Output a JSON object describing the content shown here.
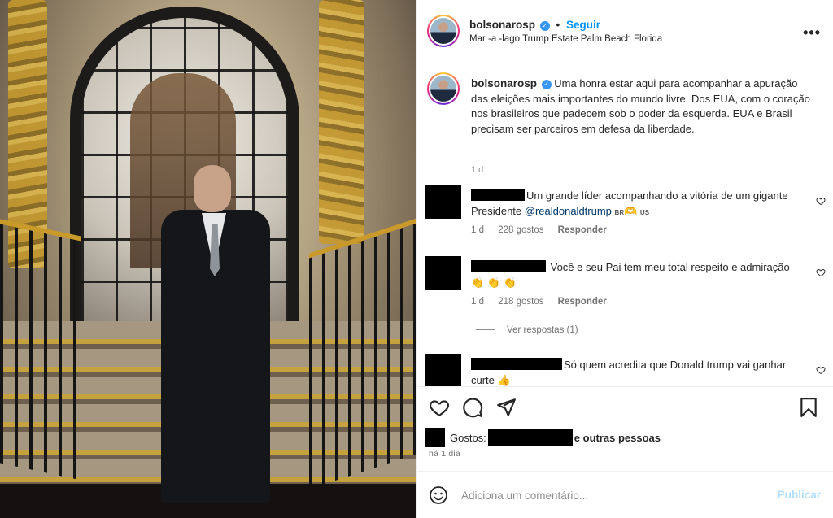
{
  "post": {
    "username": "bolsonarosp",
    "follow_label": "Seguir",
    "location": "Mar -a -lago Trump Estate Palm Beach Florida",
    "more_icon": "more-options-icon",
    "caption_username": "bolsonarosp",
    "caption_text": "Uma honra estar aqui para acompanhar a apuração das eleições mais importantes do mundo livre. Dos EUA, com o coração nos brasileiros que padecem sob o poder da esquerda. EUA e Brasil precisam ser parceiros em defesa da liberdade.",
    "caption_time": "1 d"
  },
  "comments": [
    {
      "text_before": "Um grande líder acompanhando a vitória de um gigante Presidente ",
      "mention": "@realdonaldtrump",
      "flag_br": "BR",
      "emoji": "🫶",
      "flag_us": "US",
      "time": "1 d",
      "likes": "228 gostos",
      "reply_label": "Responder"
    },
    {
      "text": "Você e seu Pai tem meu total respeito e admiração",
      "emoji": "👏 👏 👏",
      "time": "1 d",
      "likes": "218 gostos",
      "reply_label": "Responder",
      "view_replies": "Ver respostas (1)"
    },
    {
      "text": "Só quem acredita que Donald trump vai ganhar curte",
      "emoji": "👍"
    }
  ],
  "actions": {
    "like_icon": "heart-icon",
    "comment_icon": "comment-icon",
    "share_icon": "share-icon",
    "save_icon": "bookmark-icon"
  },
  "likes": {
    "prefix": "Gostos:",
    "suffix": "e outras pessoas"
  },
  "posted_ago": "há 1 dia",
  "add_comment": {
    "placeholder": "Adiciona um comentário...",
    "publish_label": "Publicar"
  },
  "colors": {
    "accent": "#0095f6",
    "verified": "#3897f0",
    "mention": "#00376b",
    "publish_disabled": "#b2dffc"
  }
}
